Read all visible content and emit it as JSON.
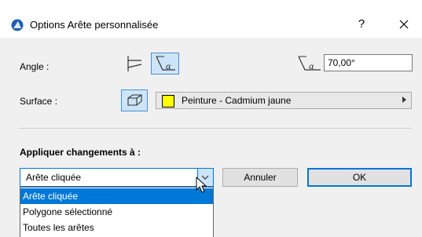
{
  "window": {
    "title": "Options Arête personnalisée",
    "help_label": "?"
  },
  "angle": {
    "label": "Angle :",
    "value": "70,00°"
  },
  "surface": {
    "label": "Surface :",
    "material": "Peinture - Cadmium jaune",
    "swatch_color": "#ffff00"
  },
  "apply": {
    "label": "Appliquer changements à :",
    "selected": "Arête cliquée",
    "options": [
      "Arête cliquée",
      "Polygone sélectionné",
      "Toutes les arêtes"
    ]
  },
  "buttons": {
    "cancel": "Annuler",
    "ok": "OK"
  },
  "icons": [
    "app-icon",
    "help-icon",
    "close-icon",
    "angle-corner-icon",
    "angle-alpha-icon",
    "angle-value-icon",
    "surface-pickup-icon",
    "submenu-arrow-icon",
    "chevron-down-icon",
    "mouse-cursor-icon"
  ],
  "colors": {
    "accent": "#0078d7",
    "active_icon_bg": "#cce4f7"
  }
}
